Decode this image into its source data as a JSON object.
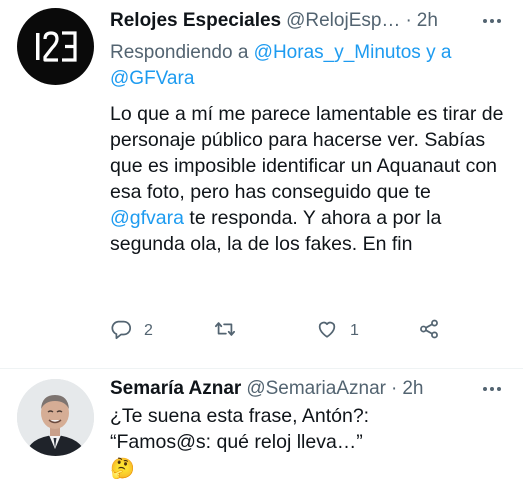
{
  "tweet1": {
    "author_name": "Relojes Especiales",
    "author_handle": "@RelojEsp…",
    "separator": "·",
    "time": "2h",
    "avatar_text": "I2E",
    "replying_prefix": "Respondiendo a",
    "replying_user1": "@Horas_y_Minutos",
    "replying_and": "y a",
    "replying_user2": "@GFVara",
    "text_before_mention": "Lo que a mí me parece lamentable es tirar de personaje público para hacerse ver. Sabías que es imposible identificar un Aquanaut con esa foto, pero has conseguido que te",
    "mention": "@gfvara",
    "text_after_mention": "te responda. Y ahora a por la segunda ola, la de los fakes. En fin",
    "reply_count": "2",
    "like_count": "1"
  },
  "tweet2": {
    "author_name": "Semaría Aznar",
    "author_handle": "@SemariaAznar",
    "separator": "·",
    "time": "2h",
    "line1": "¿Te suena esta frase, Antón?:",
    "line2": "“Famos@s: qué reloj lleva…”",
    "emoji": "🤔"
  },
  "colors": {
    "text": "#0f1419",
    "muted": "#536471",
    "link": "#1d9bf0"
  },
  "icons": [
    "more-icon",
    "reply-icon",
    "retweet-icon",
    "like-icon",
    "share-icon",
    "thinking-face-emoji"
  ]
}
